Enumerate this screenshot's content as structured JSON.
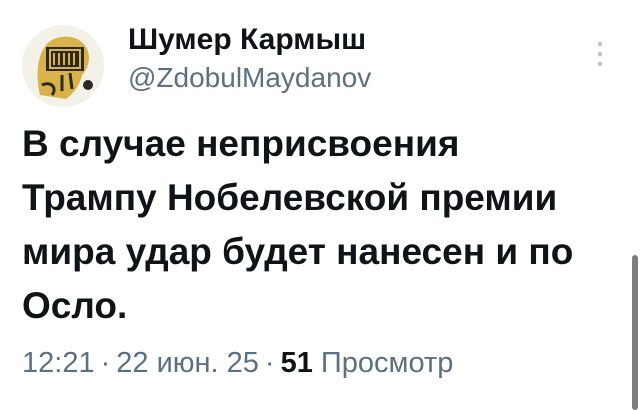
{
  "author": {
    "display_name": "Шумер Кармыш",
    "handle": "@ZdobulMaydanov",
    "avatar_icon": "avatar-illustration"
  },
  "menu_icon": "more-vertical-icon",
  "tweet": {
    "text_lines": [
      "В случае неприсвоения",
      "Трампу Нобелевской премии",
      "мира удар будет нанесен и по",
      "Осло."
    ],
    "time": "12:21",
    "date": "22 июн. 25",
    "separator": "·",
    "views_count": "51",
    "views_label": "Просмотр"
  },
  "colors": {
    "text": "#0f1419",
    "secondary": "#5b7083",
    "background": "#ffffff"
  }
}
